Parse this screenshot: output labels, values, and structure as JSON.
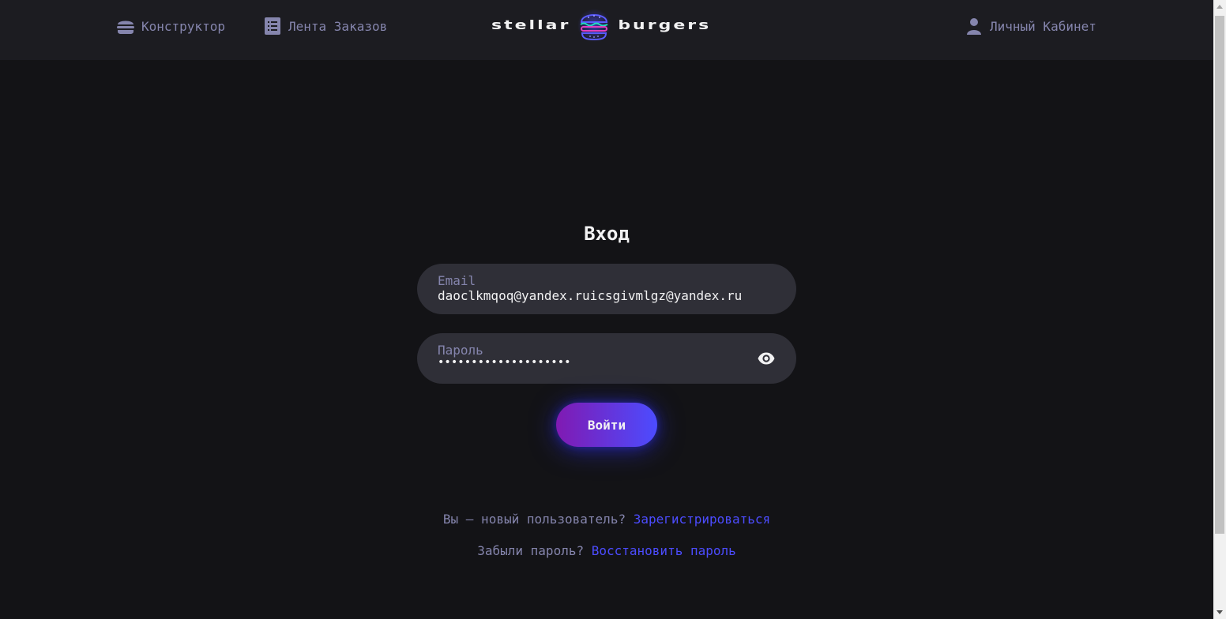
{
  "header": {
    "nav_constructor": "Конструктор",
    "nav_feed": "Лента Заказов",
    "nav_account": "Личный Кабинет",
    "logo_left": "stellar",
    "logo_right": "burgers"
  },
  "login": {
    "title": "Вход",
    "email_label": "Email",
    "email_value": "daoclkmqoq@yandex.ruicsgivmlgz@yandex.ru",
    "password_label": "Пароль",
    "password_value": "••••••••••••••••••••",
    "submit_label": "Войти"
  },
  "helpers": {
    "register_text": "Вы — новый пользователь?",
    "register_link": "Зарегистрироваться",
    "forgot_text": "Забыли пароль?",
    "forgot_link": "Восстановить пароль"
  },
  "colors": {
    "background": "#131316",
    "header": "#1c1c21",
    "input": "#2f2f37",
    "muted": "#8585ad",
    "accent": "#4c4cff",
    "gradient_start": "#801ab2"
  },
  "icons": {
    "constructor": "burger-icon",
    "feed": "list-icon",
    "account": "profile-icon",
    "password_toggle": "eye-icon"
  }
}
